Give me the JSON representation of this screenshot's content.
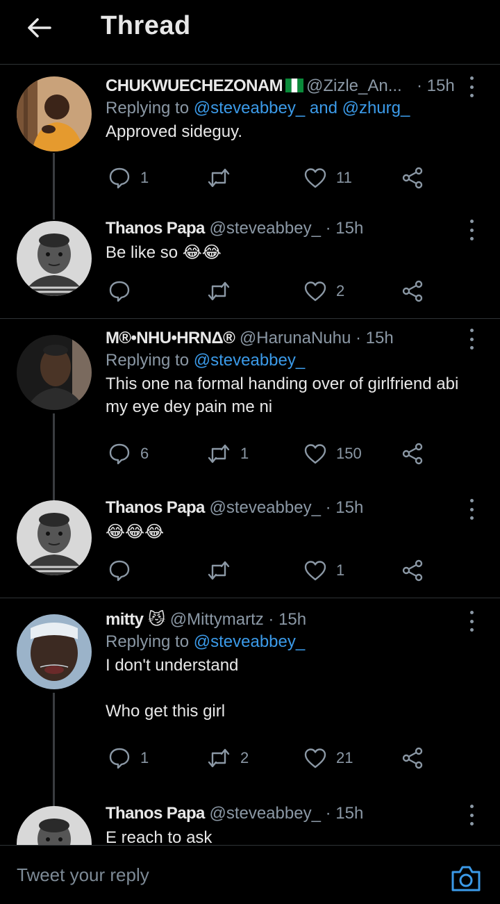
{
  "header": {
    "title": "Thread"
  },
  "tweets": [
    {
      "name": "CHUKWUECHEZONAM",
      "handle": "@Zizle_An...",
      "time": "· 15h",
      "replying_prefix": "Replying to",
      "replying_mentions": "@steveabbey_ and @zhurg_",
      "text": "Approved sideguy.",
      "replies": "1",
      "retweets": "",
      "likes": "11"
    },
    {
      "name": "Thanos Papa",
      "handle": "@steveabbey_",
      "time": "· 15h",
      "text": "Be like so 😂😂",
      "replies": "",
      "retweets": "",
      "likes": "2"
    },
    {
      "name": "M®•NHU•HRNΔ®",
      "handle": "@HarunaNuhu",
      "time": "· 15h",
      "replying_prefix": "Replying to",
      "replying_mentions": "@steveabbey_",
      "text": "This one na formal handing over of girlfriend abi\nmy eye dey pain me ni",
      "replies": "6",
      "retweets": "1",
      "likes": "150"
    },
    {
      "name": "Thanos Papa",
      "handle": "@steveabbey_",
      "time": "· 15h",
      "text": "😂😂😂",
      "replies": "",
      "retweets": "",
      "likes": "1"
    },
    {
      "name": "mitty",
      "name_emoji": "😼",
      "handle": "@Mittymartz",
      "time": "· 15h",
      "replying_prefix": "Replying to",
      "replying_mentions": "@steveabbey_",
      "text": "I don't understand\n\nWho get this girl",
      "replies": "1",
      "retweets": "2",
      "likes": "21"
    },
    {
      "name": "Thanos Papa",
      "handle": "@steveabbey_",
      "time": "· 15h",
      "text": "E reach to ask"
    }
  ],
  "reply_bar": {
    "placeholder": "Tweet your reply"
  },
  "colors": {
    "background": "#000000",
    "link": "#3b9ae8",
    "muted": "#8b98a5",
    "text": "#e8e8e8",
    "divider": "#2f3336"
  },
  "icons": [
    "back-arrow-icon",
    "reply-icon",
    "retweet-icon",
    "like-icon",
    "share-icon",
    "more-icon",
    "camera-icon",
    "nigeria-flag-icon"
  ]
}
